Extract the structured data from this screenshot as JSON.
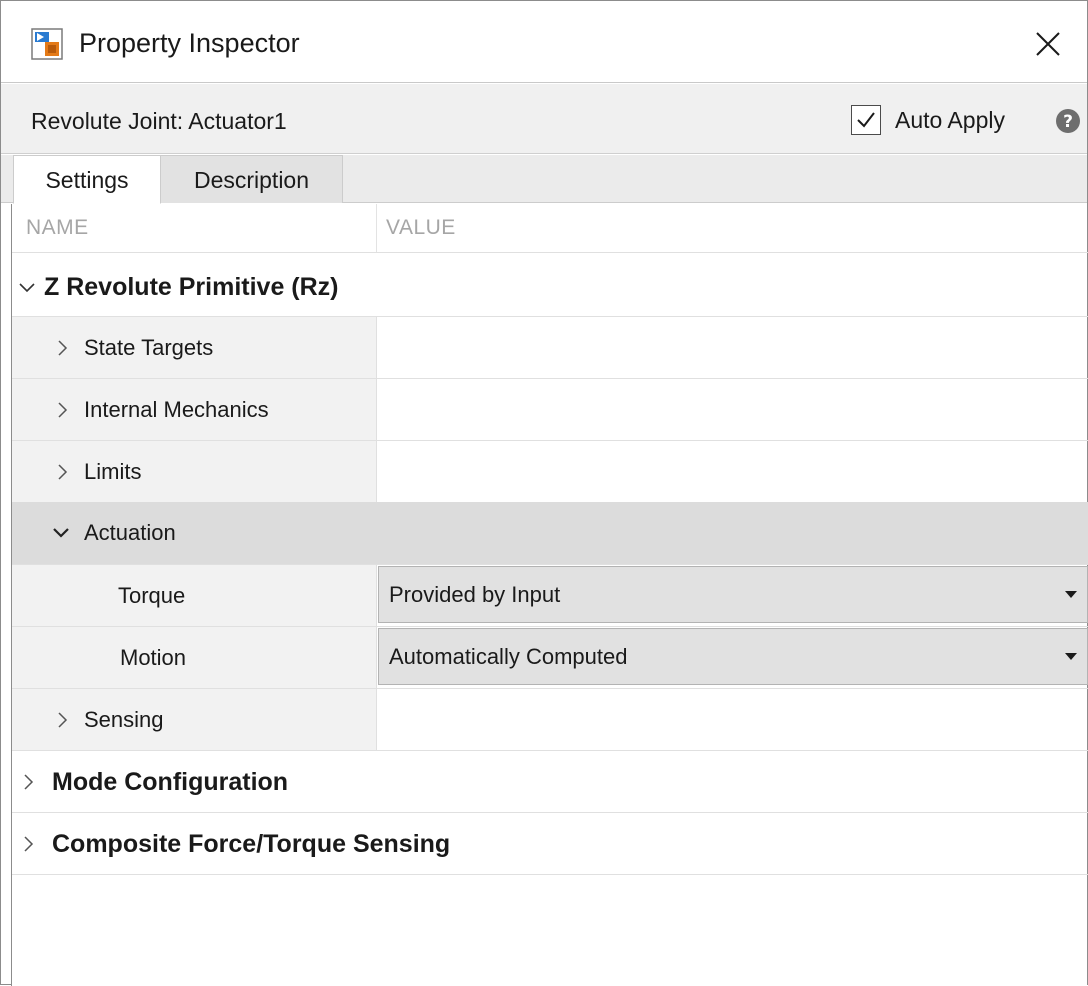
{
  "window": {
    "title": "Property Inspector",
    "app_icon": "simulink-block-icon",
    "close_icon": "close-icon"
  },
  "header": {
    "block_name": "Revolute Joint: Actuator1",
    "auto_apply_label": "Auto Apply",
    "auto_apply_checked": true,
    "help_icon": "help-icon"
  },
  "tabs": [
    {
      "label": "Settings",
      "active": true
    },
    {
      "label": "Description",
      "active": false
    }
  ],
  "table": {
    "columns": {
      "name": "NAME",
      "value": "VALUE"
    },
    "sections": [
      {
        "label": "Z Revolute Primitive (Rz)",
        "expanded": true,
        "children": [
          {
            "label": "State Targets",
            "expanded": false
          },
          {
            "label": "Internal Mechanics",
            "expanded": false
          },
          {
            "label": "Limits",
            "expanded": false
          },
          {
            "label": "Actuation",
            "expanded": true,
            "selected": true,
            "params": [
              {
                "label": "Torque",
                "value": "Provided by Input"
              },
              {
                "label": "Motion",
                "value": "Automatically Computed"
              }
            ]
          },
          {
            "label": "Sensing",
            "expanded": false
          }
        ]
      },
      {
        "label": "Mode Configuration",
        "expanded": false
      },
      {
        "label": "Composite Force/Torque Sensing",
        "expanded": false
      }
    ]
  },
  "colors": {
    "selected_row": "#dcdcdc",
    "header_bg": "#f0f0f0",
    "dropdown_bg": "#e1e1e1"
  }
}
